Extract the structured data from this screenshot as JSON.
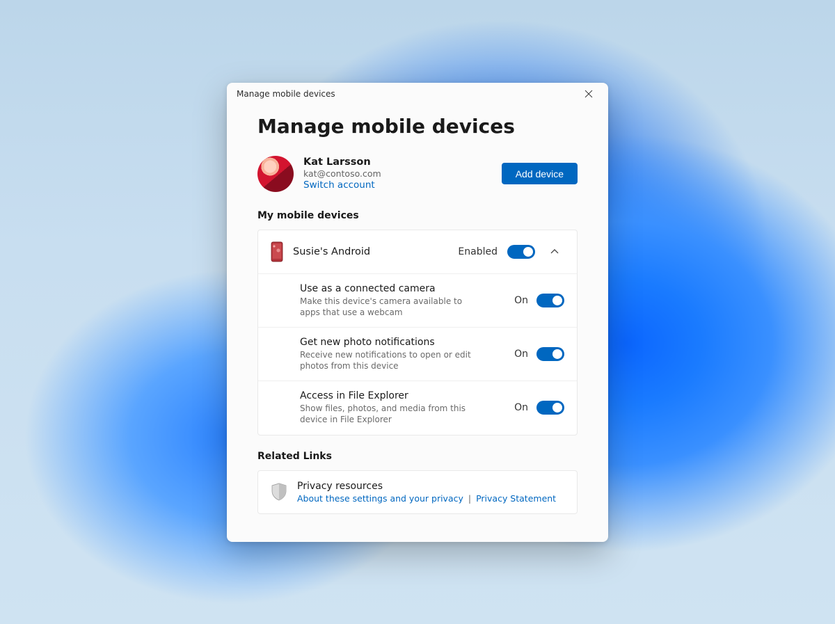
{
  "window": {
    "title": "Manage mobile devices"
  },
  "page": {
    "heading": "Manage mobile devices"
  },
  "account": {
    "displayName": "Kat Larsson",
    "email": "kat@contoso.com",
    "switchAccount": "Switch account",
    "addDevice": "Add device"
  },
  "sections": {
    "devicesHeading": "My mobile devices",
    "relatedHeading": "Related Links"
  },
  "device": {
    "name": "Susie's Android",
    "enabledLabel": "Enabled",
    "settings": [
      {
        "title": "Use as a connected camera",
        "description": "Make this device's camera available to apps that use a webcam",
        "toggleLabel": "On"
      },
      {
        "title": "Get new photo notifications",
        "description": "Receive new notifications to open or edit photos from this device",
        "toggleLabel": "On"
      },
      {
        "title": "Access in File Explorer",
        "description": "Show files, photos, and media from this device in File Explorer",
        "toggleLabel": "On"
      }
    ]
  },
  "privacy": {
    "title": "Privacy resources",
    "link1": "About these settings and your privacy",
    "separator": "|",
    "link2": "Privacy Statement"
  }
}
